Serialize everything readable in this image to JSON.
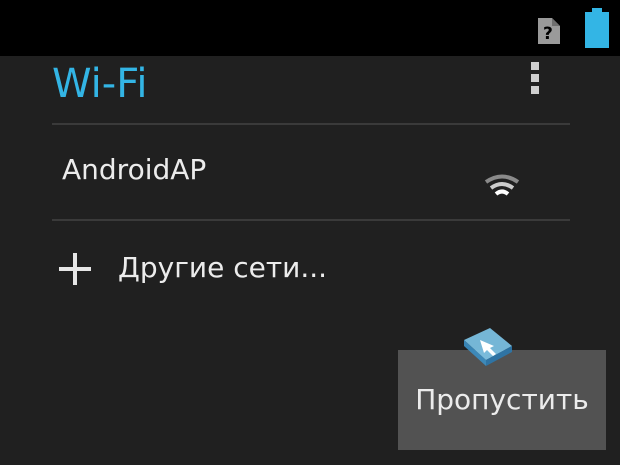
{
  "status_bar": {
    "sim_icon": "sim-unknown-icon",
    "battery_icon": "battery-full-icon",
    "colors": {
      "background": "#000000",
      "battery": "#33b5e5",
      "sim": "#9a9a9a"
    }
  },
  "header": {
    "title": "Wi-Fi",
    "menu_icon": "overflow-menu-icon",
    "accent_color": "#33b5e5"
  },
  "networks": [
    {
      "name": "AndroidAP",
      "icon": "wifi-signal-icon"
    }
  ],
  "other_networks": {
    "icon": "plus-icon",
    "label": "Другие сети..."
  },
  "footer": {
    "skip_label": "Пропустить"
  },
  "watermark": {
    "icon": "logo-icon"
  }
}
